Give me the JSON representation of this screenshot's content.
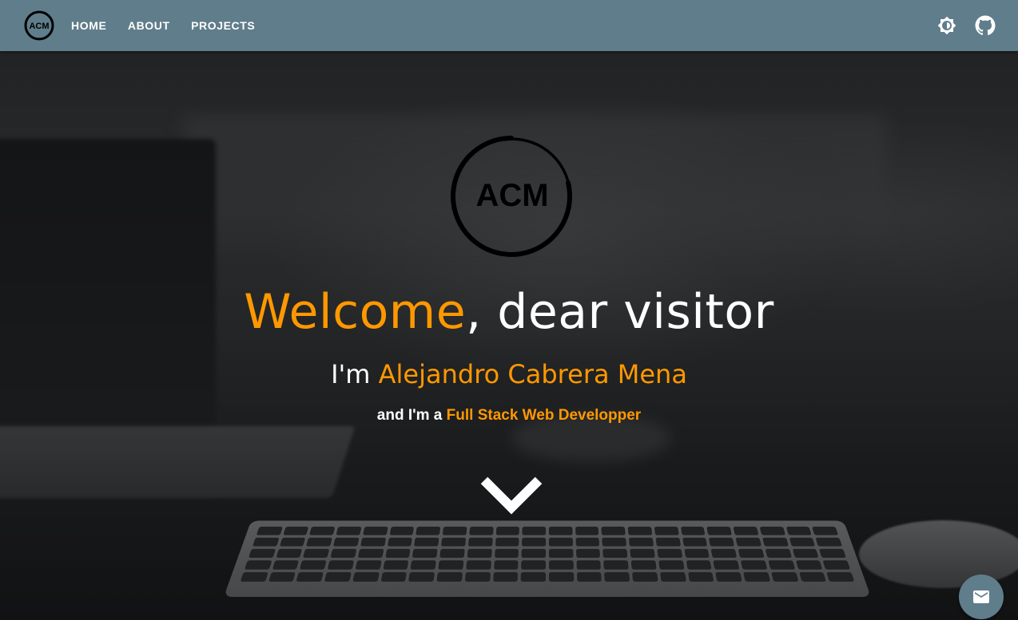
{
  "header": {
    "logo_text": "ACM",
    "nav": [
      {
        "label": "HOME"
      },
      {
        "label": "ABOUT"
      },
      {
        "label": "PROJECTS"
      }
    ],
    "theme_toggle_icon": "brightness-icon",
    "github_icon": "github-icon",
    "bar_color": "#607d8b"
  },
  "hero": {
    "logo_text": "ACM",
    "welcome_accent": "Welcome",
    "welcome_rest": ", dear visitor",
    "name_prefix": "I'm ",
    "name": "Alejandro Cabrera Mena",
    "role_prefix": "and I'm a ",
    "role": "Full Stack Web Developper",
    "scroll_icon": "chevron-down-icon",
    "accent_color": "#ff9800"
  },
  "fab": {
    "icon": "mail-icon"
  }
}
